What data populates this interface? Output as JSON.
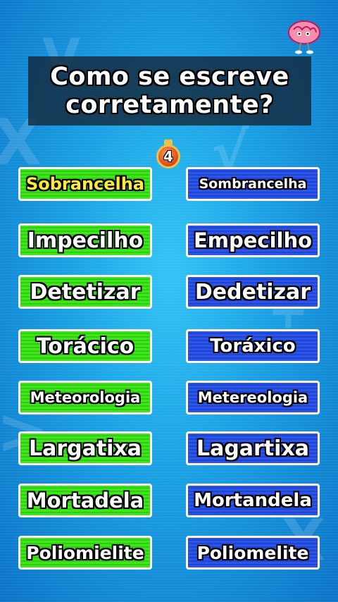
{
  "title": {
    "line1": "Como se escreve",
    "line2": "corretamente?"
  },
  "timer": {
    "value": "4"
  },
  "options": {
    "row1": {
      "left": "Sobrancelha",
      "right": "Sombrancelha"
    },
    "row2": {
      "left": "Impecilho",
      "right": "Empecilho"
    },
    "row3": {
      "left": "Detetizar",
      "right": "Dedetizar"
    },
    "row4": {
      "left": "Torácico",
      "right": "Toráxico"
    },
    "row5": {
      "left": "Meteorologia",
      "right": "Metereologia"
    },
    "row6": {
      "left": "Largatixa",
      "right": "Lagartixa"
    },
    "row7": {
      "left": "Mortadela",
      "right": "Mortandela"
    },
    "row8": {
      "left": "Poliomielite",
      "right": "Poliomelite"
    }
  },
  "colors": {
    "left_column": "#3ee61a",
    "right_column": "#2a55e8",
    "highlight_text": "#ffe93a",
    "background": "#1a9fe3"
  },
  "icons": [
    "brain-mascot-icon",
    "stopwatch-icon"
  ]
}
